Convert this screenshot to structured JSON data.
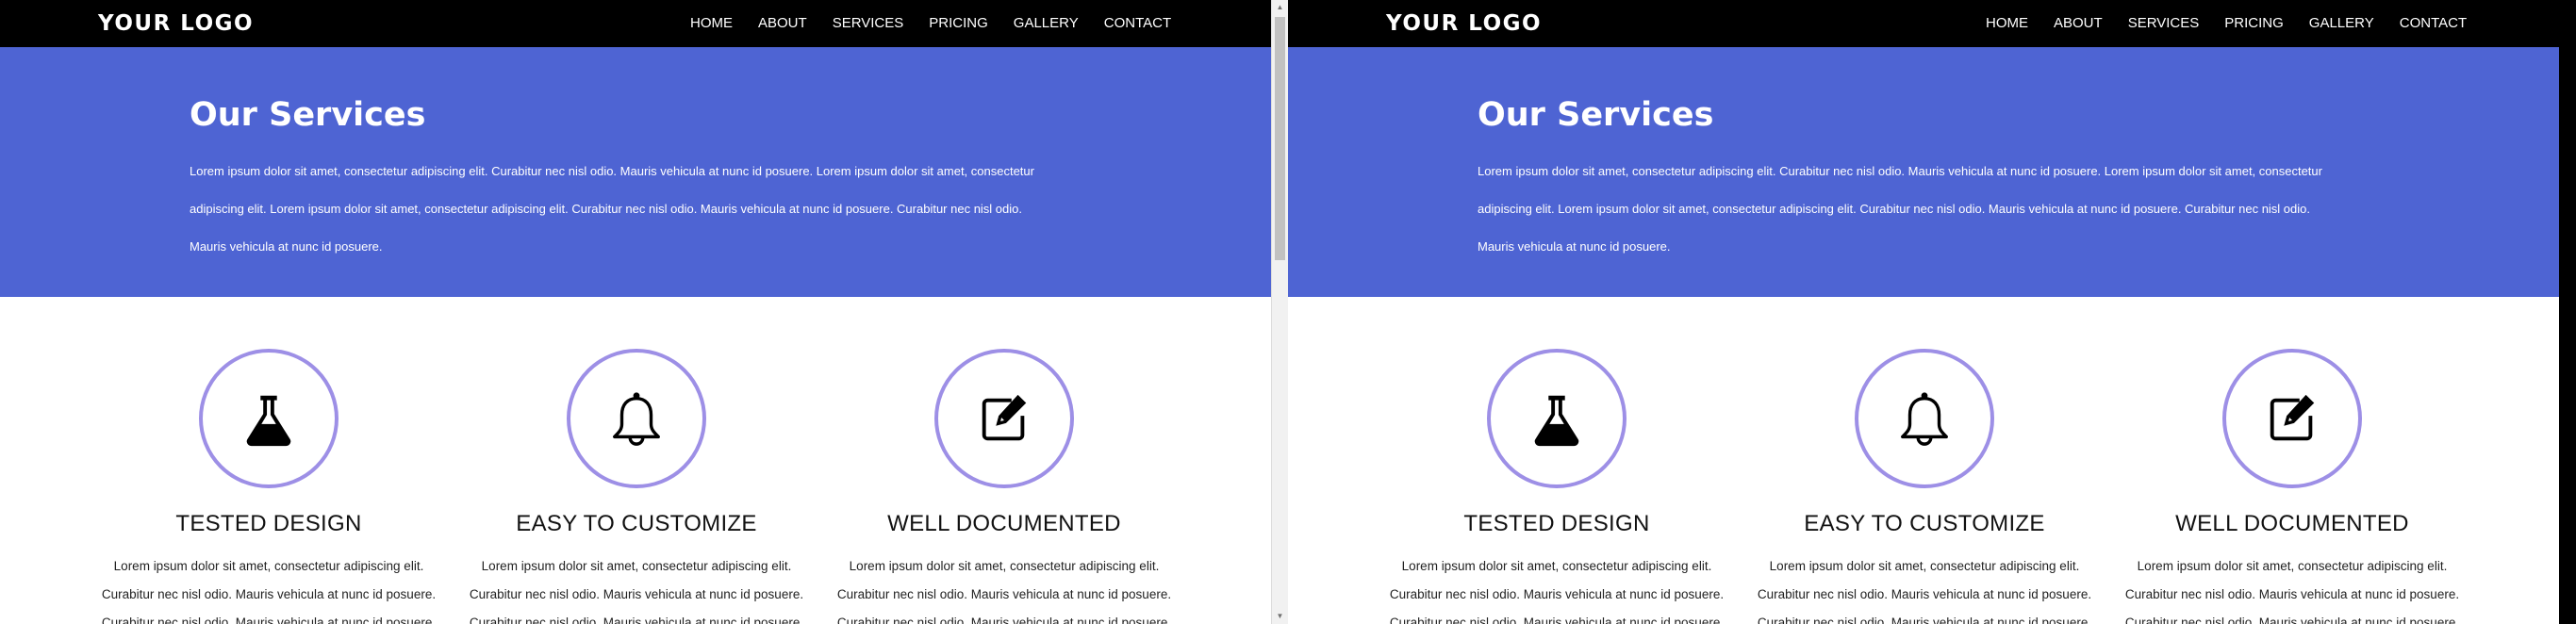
{
  "logo": "YOUR LOGO",
  "nav": {
    "items": [
      {
        "label": "HOME"
      },
      {
        "label": "ABOUT"
      },
      {
        "label": "SERVICES"
      },
      {
        "label": "PRICING"
      },
      {
        "label": "GALLERY"
      },
      {
        "label": "CONTACT"
      }
    ]
  },
  "hero": {
    "title": "Our Services",
    "text": "Lorem ipsum dolor sit amet, consectetur adipiscing elit. Curabitur nec nisl odio. Mauris vehicula at nunc id posuere. Lorem ipsum dolor sit amet, consectetur adipiscing elit. Lorem ipsum dolor sit amet, consectetur adipiscing elit. Curabitur nec nisl odio. Mauris vehicula at nunc id posuere. Curabitur nec nisl odio. Mauris vehicula at nunc id posuere."
  },
  "services": [
    {
      "icon": "flask-icon",
      "title": "TESTED DESIGN",
      "text": "Lorem ipsum dolor sit amet, consectetur adipiscing elit. Curabitur nec nisl odio. Mauris vehicula at nunc id posuere. Curabitur nec nisl odio. Mauris vehicula at nunc id posuere."
    },
    {
      "icon": "bell-icon",
      "title": "EASY TO CUSTOMIZE",
      "text": "Lorem ipsum dolor sit amet, consectetur adipiscing elit. Curabitur nec nisl odio. Mauris vehicula at nunc id posuere. Curabitur nec nisl odio. Mauris vehicula at nunc id posuere."
    },
    {
      "icon": "edit-icon",
      "title": "WELL DOCUMENTED",
      "text": "Lorem ipsum dolor sit amet, consectetur adipiscing elit. Curabitur nec nisl odio. Mauris vehicula at nunc id posuere. Curabitur nec nisl odio. Mauris vehicula at nunc id posuere."
    }
  ],
  "colors": {
    "nav_background": "#000000",
    "hero_background": "#4e64d3",
    "icon_ring": "#9d8fe6",
    "scrollbar_thumb": "#c1c1c1"
  }
}
